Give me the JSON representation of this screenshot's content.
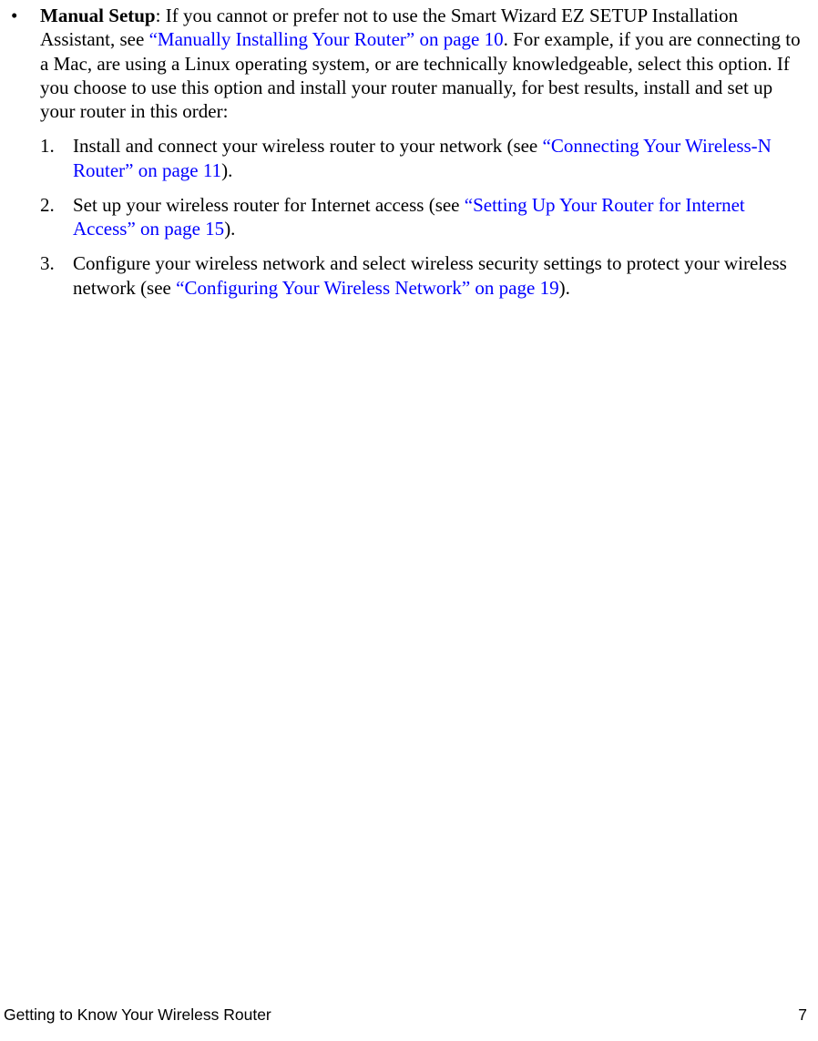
{
  "bullet": {
    "marker": "•",
    "heading": "Manual Setup",
    "text_before_link": ": If you cannot or prefer not to use the Smart Wizard EZ SETUP Installation Assistant, see  ",
    "link": "“Manually Installing Your Router” on page 10",
    "text_after_link": ". For example, if you are connecting to a Mac, are using a Linux operating system, or are technically knowledgeable, select this option. If you choose to use this option and install your router manually, for best results, install and set up your router in this order:"
  },
  "steps": [
    {
      "num": "1.",
      "before": "Install and connect your wireless router to your network (see ",
      "link": "“Connecting Your Wireless-N Router” on page 11",
      "after": ")."
    },
    {
      "num": "2.",
      "before": "Set up your wireless router for Internet access (see ",
      "link": "“Setting Up Your Router for Internet Access” on page 15",
      "after": ")."
    },
    {
      "num": "3.",
      "before": "Configure your wireless network and select wireless security settings to protect your wireless network (see ",
      "link": "“Configuring Your Wireless Network” on page 19",
      "after": ")."
    }
  ],
  "footer": {
    "section": "Getting to Know Your Wireless Router",
    "page": "7"
  }
}
